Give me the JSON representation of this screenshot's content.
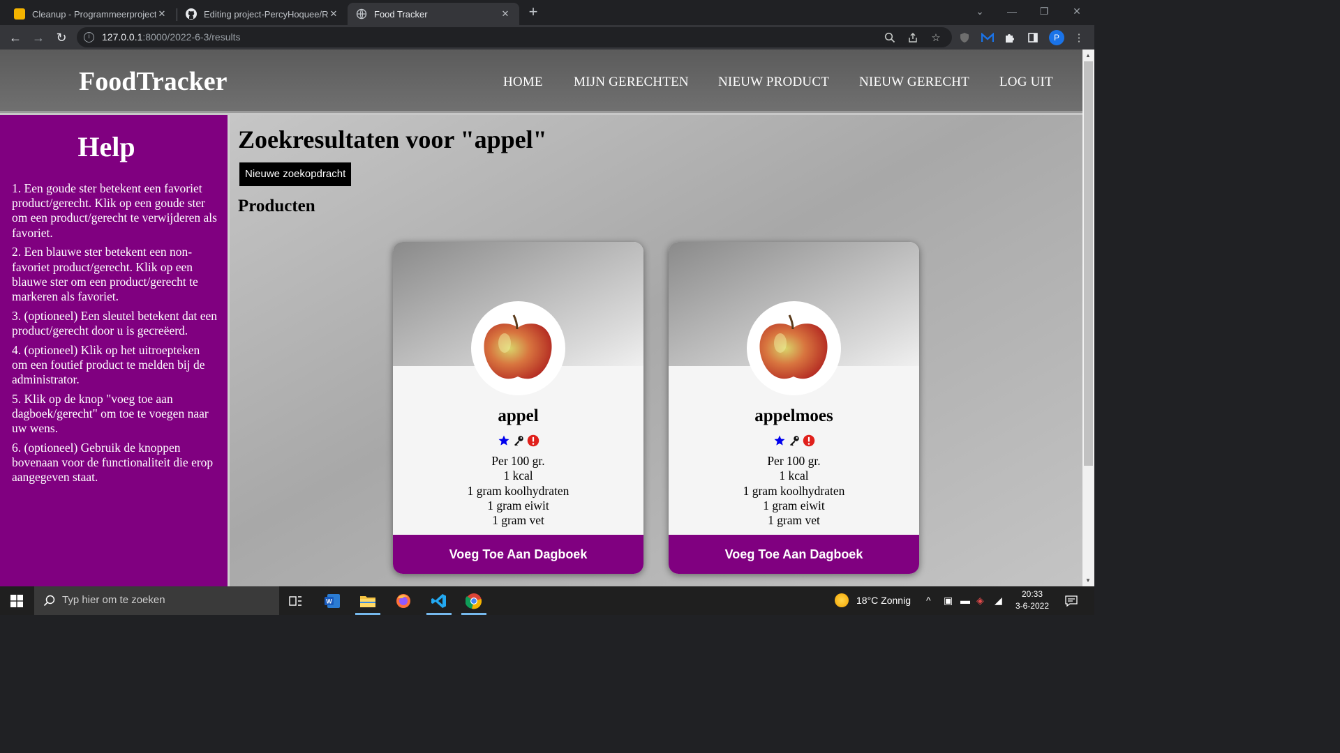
{
  "browser": {
    "tabs": [
      {
        "title": "Cleanup - Programmeerproject",
        "favicon": "slides-icon",
        "active": false
      },
      {
        "title": "Editing project-PercyHoquee/README.md",
        "favicon": "github-icon",
        "active": false
      },
      {
        "title": "Food Tracker",
        "favicon": "globe-icon",
        "active": true
      }
    ],
    "close_glyph": "✕",
    "url_host": "127.0.0.1",
    "url_rest": ":8000/2022-6-3/results",
    "profile_initial": "P"
  },
  "site": {
    "brand": "FoodTracker",
    "nav": [
      "HOME",
      "MIJN GERECHTEN",
      "NIEUW PRODUCT",
      "NIEUW GERECHT",
      "LOG UIT"
    ]
  },
  "help": {
    "title": "Help",
    "items": [
      "1. Een goude ster betekent een favoriet product/gerecht. Klik op een goude ster om een product/gerecht te verwijderen als favoriet.",
      "2. Een blauwe ster betekent een non-favoriet product/gerecht. Klik op een blauwe ster om een product/gerecht te markeren als favoriet.",
      "3. (optioneel) Een sleutel betekent dat een product/gerecht door u is gecreëerd.",
      "4. (optioneel) Klik op het uitroepteken om een foutief product te melden bij de administrator.",
      "5. Klik op de knop \"voeg toe aan dagboek/gerecht\" om toe te voegen naar uw wens.",
      "6. (optioneel) Gebruik de knoppen bovenaan voor de functionaliteit die erop aangegeven staat."
    ]
  },
  "results": {
    "title": "Zoekresultaten voor \"appel\"",
    "new_search_label": "Nieuwe zoekopdracht",
    "section_title": "Producten",
    "products": [
      {
        "name": "appel",
        "icons": [
          "blue-star-icon",
          "key-icon",
          "report-exclamation-icon"
        ],
        "facts": [
          "Per 100 gr.",
          "1 kcal",
          "1 gram koolhydraten",
          "1 gram eiwit",
          "1 gram vet"
        ],
        "button_label": "Voeg Toe Aan Dagboek"
      },
      {
        "name": "appelmoes",
        "icons": [
          "blue-star-icon",
          "key-icon",
          "report-exclamation-icon"
        ],
        "facts": [
          "Per 100 gr.",
          "1 kcal",
          "1 gram koolhydraten",
          "1 gram eiwit",
          "1 gram vet"
        ],
        "button_label": "Voeg Toe Aan Dagboek"
      }
    ]
  },
  "taskbar": {
    "search_placeholder": "Typ hier om te zoeken",
    "weather": "18°C  Zonnig",
    "time": "20:33",
    "date": "3-6-2022"
  },
  "colors": {
    "accent_purple": "#800080",
    "star_blue": "#0000ee",
    "alert_red": "#e0201b"
  }
}
